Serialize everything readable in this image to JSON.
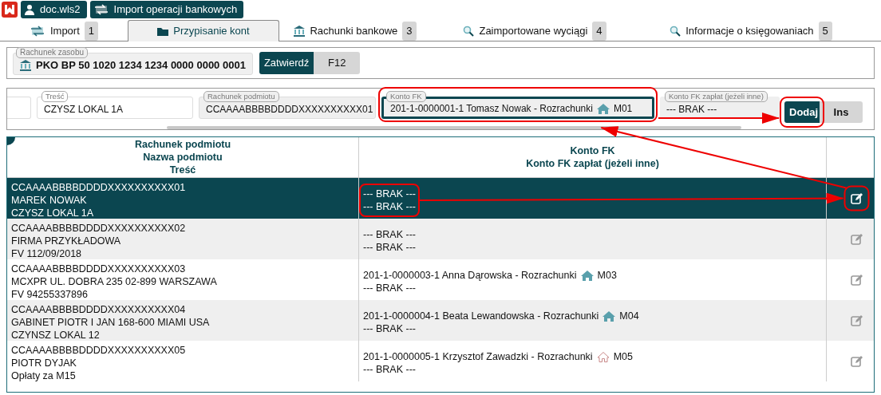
{
  "app_buttons": [
    {
      "kind": "user",
      "label": "doc.wls2"
    },
    {
      "kind": "transfer",
      "label": "Import operacji bankowych"
    }
  ],
  "tabs": [
    {
      "kind": "transfer",
      "label": "Import",
      "badge": "1",
      "selected": false
    },
    {
      "kind": "folder",
      "label": "Przypisanie kont",
      "selected": true
    },
    {
      "kind": "bank",
      "label": "Rachunki bankowe",
      "badge": "3",
      "selected": false
    },
    {
      "kind": "search",
      "label": "Zaimportowane wyciągi",
      "badge": "4",
      "selected": false
    },
    {
      "kind": "search",
      "label": "Informacje o księgowaniach",
      "badge": "5",
      "selected": false
    }
  ],
  "resource_account": {
    "label": "Rachunek zasobu",
    "value": "PKO BP 50 1020 1234 1234 0000 0000 0001"
  },
  "confirm_button": {
    "label": "Zatwierdź",
    "shortcut": "F12"
  },
  "entry_form": {
    "fields": [
      {
        "kind": "blank"
      },
      {
        "kind": "text",
        "label": "Treść",
        "value": "CZYSZ LOKAL 1A"
      },
      {
        "kind": "readonly",
        "label": "Rachunek podmiotu",
        "value": "CCAAAABBBBDDDDXXXXXXXXXX01"
      },
      {
        "kind": "account",
        "label": "Konto FK",
        "value": "201-1-0000001-1 Tomasz Nowak - Rozrachunki",
        "marker": {
          "kind": "filled",
          "code": "M01"
        }
      },
      {
        "kind": "text",
        "label": "Konto FK zapłat (jeżeli inne)",
        "value": "--- BRAK ---"
      }
    ],
    "add_button": {
      "label": "Dodaj",
      "shortcut": "Ins"
    }
  },
  "table": {
    "columns": [
      [
        "Rachunek podmiotu",
        "Nazwa podmiotu",
        "Treść"
      ],
      [
        "Konto FK",
        "Konto FK zapłat (jeżeli inne)"
      ]
    ],
    "rows": [
      {
        "selected": true,
        "account": "CCAAAABBBBDDDDXXXXXXXXXX01",
        "name": "MAREK NOWAK",
        "description": "CZYSZ LOKAL 1A",
        "konto_fk": {
          "account": "--- BRAK ---"
        },
        "konto_fk_zaplat": "--- BRAK ---"
      },
      {
        "selected": false,
        "account": "CCAAAABBBBDDDDXXXXXXXXXX02",
        "name": "FIRMA PRZYKŁADOWA",
        "description": "FV 112/09/2018",
        "konto_fk": {
          "account": "--- BRAK ---"
        },
        "konto_fk_zaplat": "--- BRAK ---"
      },
      {
        "selected": false,
        "account": "CCAAAABBBBDDDDXXXXXXXXXX03",
        "name": "MCXPR UL. DOBRA 235 02-899 WARSZAWA",
        "description": "FV 94255337896",
        "konto_fk": {
          "account": "201-1-0000003-1 Anna Dąrowska - Rozrachunki",
          "marker": {
            "kind": "filled",
            "code": "M03"
          }
        },
        "konto_fk_zaplat": "--- BRAK ---"
      },
      {
        "selected": false,
        "account": "CCAAAABBBBDDDDXXXXXXXXXX04",
        "name": "GABINET PIOTR I JAN 168-600 MIAMI USA",
        "description": "CZYNSZ LOKAL 12",
        "konto_fk": {
          "account": "201-1-0000004-1 Beata Lewandowska - Rozrachunki",
          "marker": {
            "kind": "filled",
            "code": "M04"
          }
        },
        "konto_fk_zaplat": "--- BRAK ---"
      },
      {
        "selected": false,
        "account": "CCAAAABBBBDDDDXXXXXXXXXX05",
        "name": "PIOTR DYJAK",
        "description": "Opłaty za M15",
        "konto_fk": {
          "account": "201-1-0000005-1 Krzysztof Zawadzki - Rozrachunki",
          "marker": {
            "kind": "outline",
            "code": "M05"
          }
        },
        "konto_fk_zaplat": "--- BRAK ---"
      }
    ]
  }
}
